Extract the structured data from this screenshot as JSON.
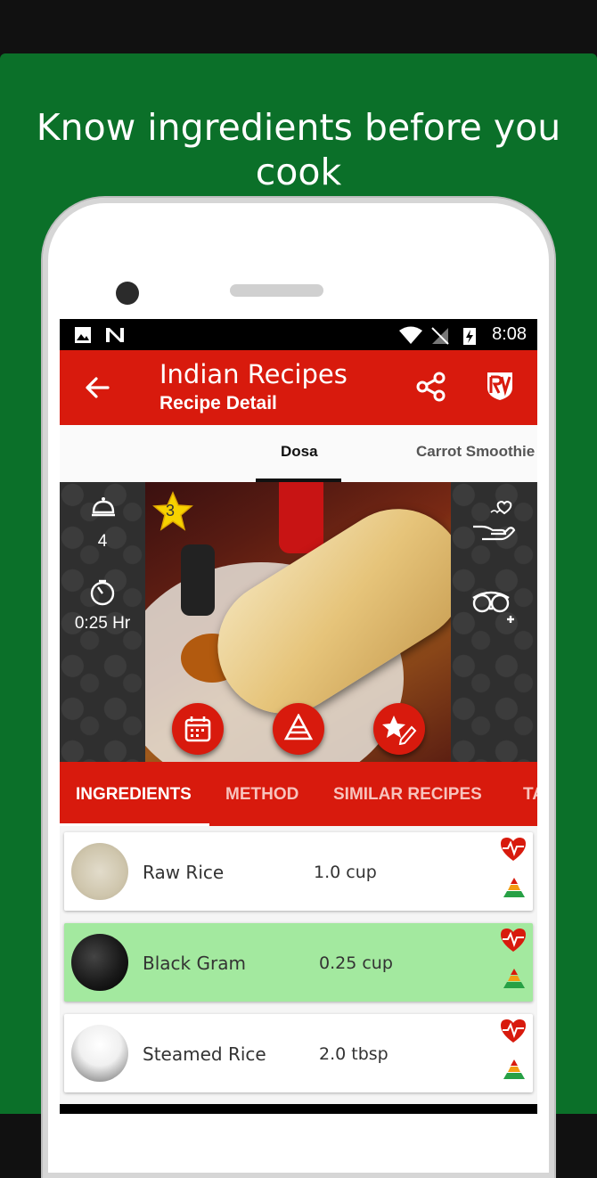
{
  "promo": {
    "headline_line1": "Know ingredients before you",
    "headline_line2": "cook"
  },
  "status_bar": {
    "time": "8:08"
  },
  "app_bar": {
    "title": "Indian Recipes",
    "subtitle": "Recipe Detail"
  },
  "recipe_tabs": [
    {
      "label": "Dosa",
      "active": true
    },
    {
      "label": "Carrot Smoothie",
      "active": false
    }
  ],
  "hero": {
    "rating": "3",
    "servings": "4",
    "cook_time": "0:25 Hr"
  },
  "detail_tabs": [
    {
      "label": "INGREDIENTS",
      "active": true
    },
    {
      "label": "METHOD",
      "active": false
    },
    {
      "label": "SIMILAR RECIPES",
      "active": false
    },
    {
      "label": "TA",
      "active": false
    }
  ],
  "ingredients": [
    {
      "name": "Raw Rice",
      "qty": "1.0 cup",
      "highlighted": false
    },
    {
      "name": "Black Gram",
      "qty": "0.25 cup",
      "highlighted": true
    },
    {
      "name": "Steamed Rice",
      "qty": "2.0 tbsp",
      "highlighted": false
    }
  ],
  "colors": {
    "promo_bg": "#0b7029",
    "accent": "#d81a0d",
    "highlight_row": "#a3e99f"
  }
}
